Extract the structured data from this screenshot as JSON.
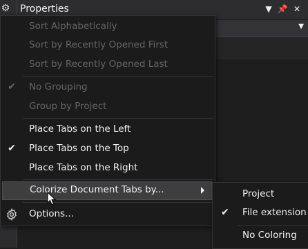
{
  "colors": {
    "accent": "#3e3e40",
    "text": "#f1f1f1",
    "disabled_text": "#656565",
    "menu_bg": "#1b1b1c"
  },
  "panel": {
    "title": "Properties"
  },
  "menu": {
    "sort_items": [
      {
        "label": "Sort Alphabetically",
        "enabled": false,
        "checked": false
      },
      {
        "label": "Sort by Recently Opened First",
        "enabled": false,
        "checked": false
      },
      {
        "label": "Sort by Recently Opened Last",
        "enabled": false,
        "checked": false
      }
    ],
    "group_items": [
      {
        "label": "No Grouping",
        "enabled": false,
        "checked": true
      },
      {
        "label": "Group by Project",
        "enabled": false,
        "checked": false
      }
    ],
    "tab_items": [
      {
        "label": "Place Tabs on the Left",
        "enabled": true,
        "checked": false
      },
      {
        "label": "Place Tabs on the Top",
        "enabled": true,
        "checked": true
      },
      {
        "label": "Place Tabs on the Right",
        "enabled": true,
        "checked": false
      }
    ],
    "colorize_label": "Colorize Document Tabs by...",
    "options_label": "Options...",
    "check_glyph": "✔"
  },
  "submenu": {
    "items": [
      {
        "label": "Project",
        "checked": false
      },
      {
        "label": "File extension",
        "checked": true
      },
      {
        "label": "No Coloring",
        "checked": false
      }
    ]
  }
}
